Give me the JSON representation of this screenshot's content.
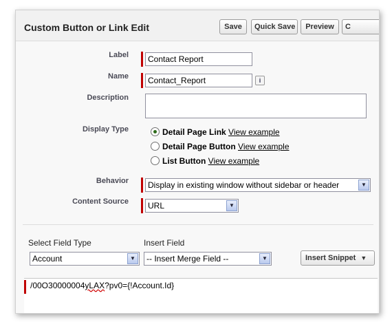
{
  "header": {
    "title": "Custom Button or Link Edit",
    "buttons": {
      "save": "Save",
      "quick_save": "Quick Save",
      "preview": "Preview",
      "cancel_partial": "C"
    }
  },
  "form": {
    "label": {
      "label": "Label",
      "value": "Contact Report"
    },
    "name": {
      "label": "Name",
      "value": "Contact_Report",
      "info": "i"
    },
    "description": {
      "label": "Description",
      "value": ""
    },
    "display_type": {
      "label": "Display Type",
      "options": [
        {
          "title": "Detail Page Link",
          "link": "View example",
          "selected": true
        },
        {
          "title": "Detail Page Button",
          "link": "View example",
          "selected": false
        },
        {
          "title": "List Button",
          "link": "View example",
          "selected": false
        }
      ]
    },
    "behavior": {
      "label": "Behavior",
      "value": "Display in existing window without sidebar or header"
    },
    "content_source": {
      "label": "Content Source",
      "value": "URL"
    }
  },
  "merge": {
    "field_type": {
      "label": "Select Field Type",
      "value": "Account"
    },
    "insert_field": {
      "label": "Insert Field",
      "value": "-- Insert Merge Field --"
    },
    "snippet_button": "Insert Snippet",
    "snippet_arrow": "▼"
  },
  "editor": {
    "code_prefix": "/00O30000004",
    "code_misspelled": "yLAX",
    "code_suffix": "?pv0={!Account.Id}"
  },
  "icons": {
    "dropdown": "▼"
  },
  "colors": {
    "required": "#c00000",
    "radio_selected": "#2d6b1a"
  }
}
